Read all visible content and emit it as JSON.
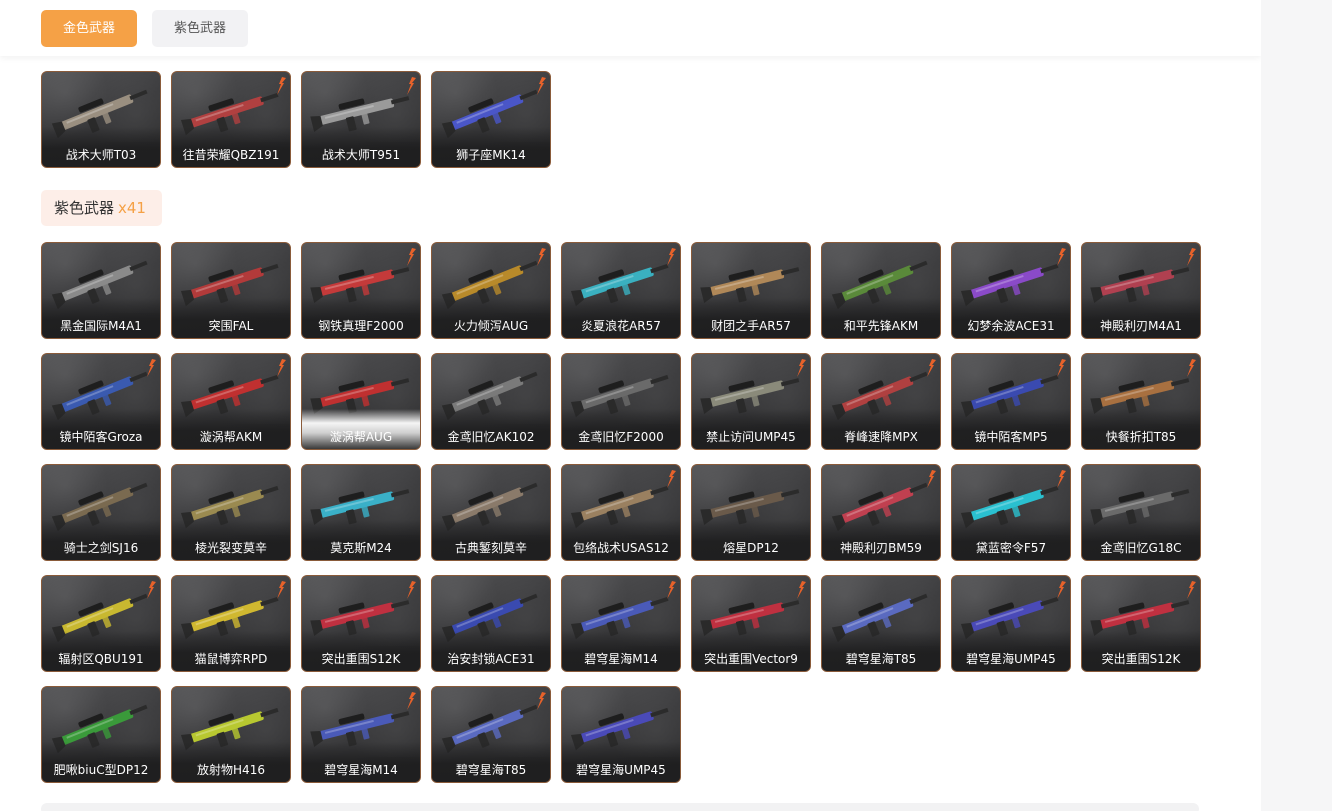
{
  "tabs": [
    {
      "label": "金色武器",
      "active": true
    },
    {
      "label": "紫色武器",
      "active": false
    }
  ],
  "gold_weapons": [
    {
      "name": "战术大师T03",
      "flame": false,
      "color": "#9a8f80"
    },
    {
      "name": "往昔荣耀QBZ191",
      "flame": true,
      "color": "#b04040"
    },
    {
      "name": "战术大师T951",
      "flame": true,
      "color": "#9a9a9a"
    },
    {
      "name": "狮子座MK14",
      "flame": true,
      "color": "#4a56c8"
    }
  ],
  "purple_section": {
    "label": "紫色武器",
    "count": "x41"
  },
  "purple_weapons": [
    {
      "name": "黑金国际M4A1",
      "flame": false,
      "color": "#8a8a8a"
    },
    {
      "name": "突围FAL",
      "flame": false,
      "color": "#b23a3a"
    },
    {
      "name": "钢铁真理F2000",
      "flame": true,
      "color": "#c43a3a"
    },
    {
      "name": "火力倾泻AUG",
      "flame": true,
      "color": "#b88a2a"
    },
    {
      "name": "炎夏浪花AR57",
      "flame": true,
      "color": "#3ab0c0"
    },
    {
      "name": "财团之手AR57",
      "flame": false,
      "color": "#b08858"
    },
    {
      "name": "和平先锋AKM",
      "flame": false,
      "color": "#5a8a3a"
    },
    {
      "name": "幻梦余波ACE31",
      "flame": true,
      "color": "#8a4ac8"
    },
    {
      "name": "神殿利刃M4A1",
      "flame": true,
      "color": "#b04050"
    },
    {
      "name": "镜中陌客Groza",
      "flame": true,
      "color": "#3a5ab0"
    },
    {
      "name": "漩涡帮AKM",
      "flame": true,
      "color": "#c03030"
    },
    {
      "name": "漩涡帮AUG",
      "flame": false,
      "color": "#c03030",
      "white_fade": true
    },
    {
      "name": "金鸢旧忆AK102",
      "flame": false,
      "color": "#7a7a7a"
    },
    {
      "name": "金鸢旧忆F2000",
      "flame": false,
      "color": "#6a6a6a"
    },
    {
      "name": "禁止访问UMP45",
      "flame": true,
      "color": "#8a8a7a"
    },
    {
      "name": "脊峰速降MPX",
      "flame": true,
      "color": "#b04040"
    },
    {
      "name": "镜中陌客MP5",
      "flame": true,
      "color": "#3a4ab0"
    },
    {
      "name": "快餐折扣T85",
      "flame": true,
      "color": "#a87040"
    },
    {
      "name": "骑士之剑SJ16",
      "flame": false,
      "color": "#7a6a50"
    },
    {
      "name": "棱光裂变莫辛",
      "flame": false,
      "color": "#9a8a50"
    },
    {
      "name": "莫克斯M24",
      "flame": false,
      "color": "#3ab0c8"
    },
    {
      "name": "古典錾刻莫辛",
      "flame": false,
      "color": "#8a7a6a"
    },
    {
      "name": "包络战术USAS12",
      "flame": true,
      "color": "#9a8060"
    },
    {
      "name": "熔星DP12",
      "flame": false,
      "color": "#6a5a4a"
    },
    {
      "name": "神殿利刃BM59",
      "flame": true,
      "color": "#c04050"
    },
    {
      "name": "黛蓝密令F57",
      "flame": true,
      "color": "#2ac0d0"
    },
    {
      "name": "金鸢旧忆G18C",
      "flame": false,
      "color": "#6a6a6a"
    },
    {
      "name": "辐射区QBU191",
      "flame": true,
      "color": "#c8b830"
    },
    {
      "name": "猫鼠博弈RPD",
      "flame": true,
      "color": "#d0b830"
    },
    {
      "name": "突出重围S12K",
      "flame": true,
      "color": "#c03040"
    },
    {
      "name": "治安封锁ACE31",
      "flame": false,
      "color": "#3a4ab0"
    },
    {
      "name": "碧穹星海M14",
      "flame": true,
      "color": "#4a5ab8"
    },
    {
      "name": "突出重围Vector9",
      "flame": true,
      "color": "#c03040"
    },
    {
      "name": "碧穹星海T85",
      "flame": false,
      "color": "#5a6ac0"
    },
    {
      "name": "碧穹星海UMP45",
      "flame": true,
      "color": "#4a4ab8"
    },
    {
      "name": "突出重围S12K",
      "flame": true,
      "color": "#c03040"
    },
    {
      "name": "肥啾biuC型DP12",
      "flame": false,
      "color": "#3a9a3a"
    },
    {
      "name": "放射物H416",
      "flame": false,
      "color": "#b8c830"
    },
    {
      "name": "碧穹星海M14",
      "flame": true,
      "color": "#4a5ab8"
    },
    {
      "name": "碧穹星海T85",
      "flame": true,
      "color": "#5a6ac0"
    },
    {
      "name": "碧穹星海UMP45",
      "flame": false,
      "color": "#4a4ab8"
    }
  ],
  "colors": {
    "accent": "#f5a146",
    "card_border": "#8a5b3a",
    "flame": "#e8622a"
  }
}
